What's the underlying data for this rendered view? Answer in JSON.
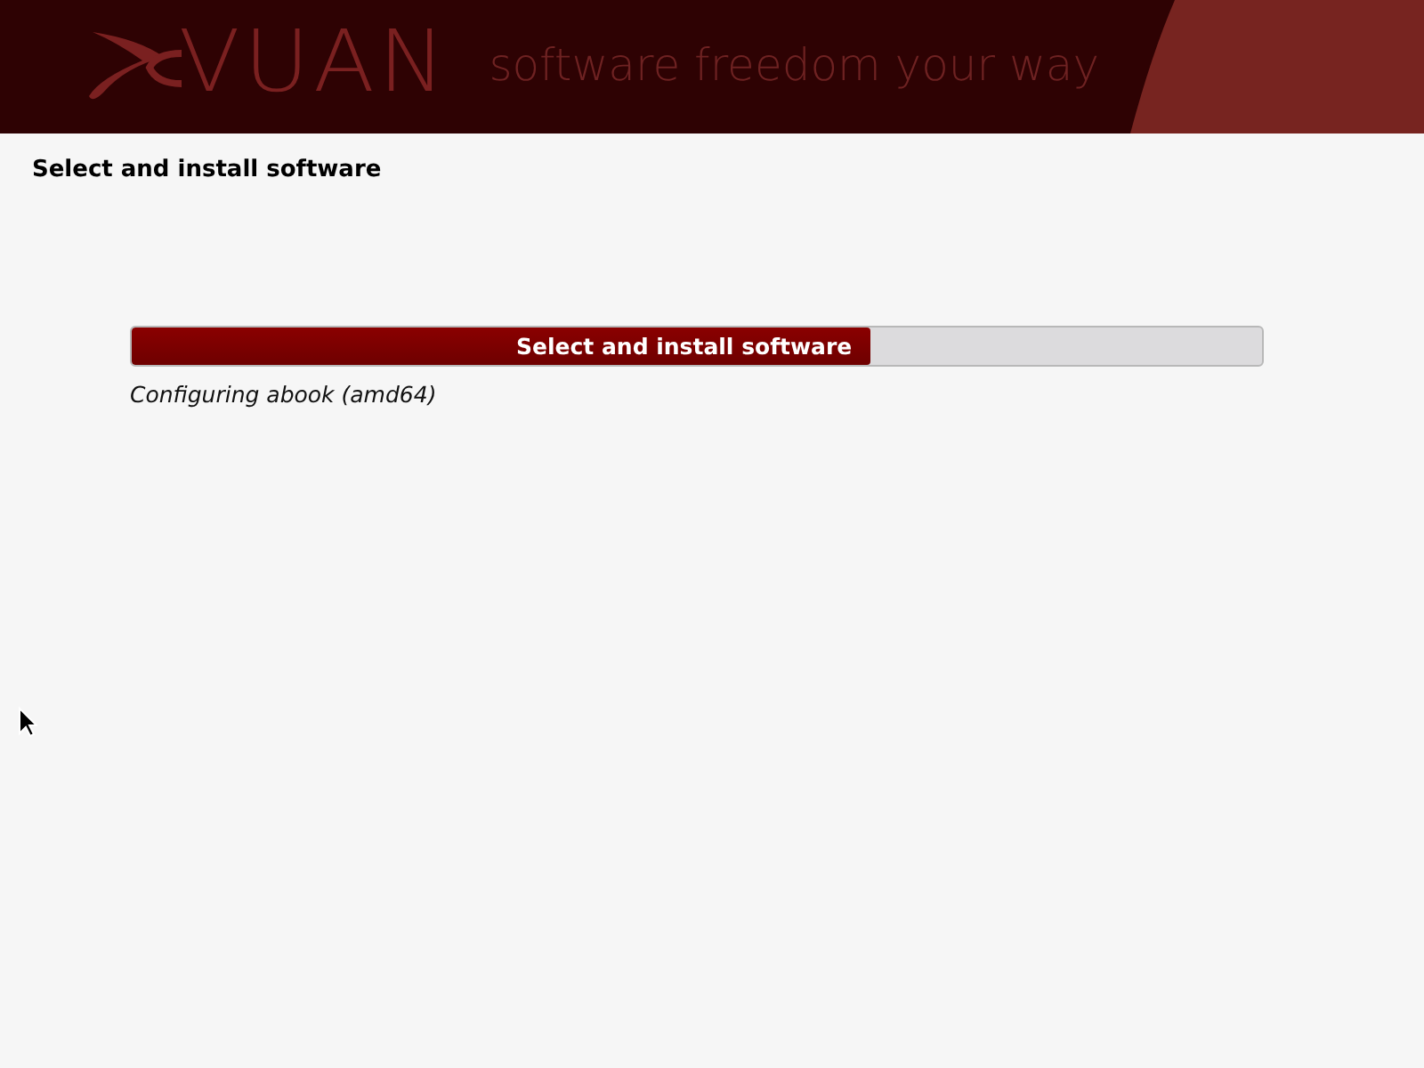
{
  "header": {
    "logo_text": "VUAN",
    "tagline": "software freedom your way"
  },
  "title": "Select and install software",
  "progress": {
    "label": "Select and install software",
    "level": 0.653,
    "status": "Configuring abook (amd64)"
  }
}
